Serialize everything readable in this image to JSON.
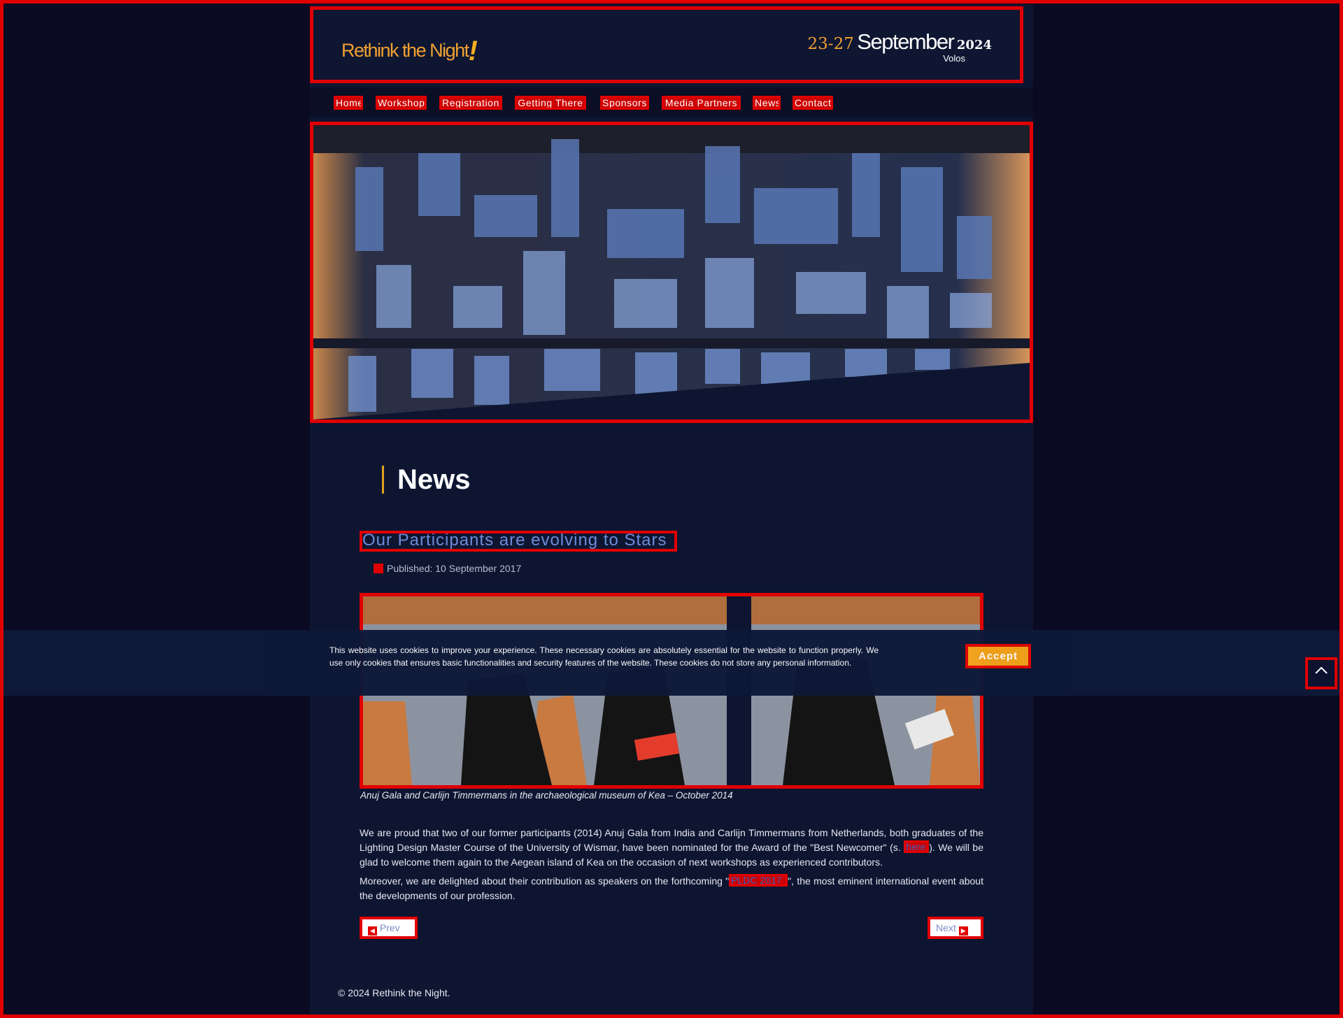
{
  "header": {
    "logo_text": "Rethink the Night",
    "logo_mark": "!",
    "dates_days": "23-27",
    "dates_month": "September",
    "dates_year": "2024",
    "city": "Volos"
  },
  "nav": {
    "items": [
      {
        "label": "Home"
      },
      {
        "label": "Workshop"
      },
      {
        "label": "Registration"
      },
      {
        "label": "Getting There"
      },
      {
        "label": "Sponsors"
      },
      {
        "label": "Media Partners"
      },
      {
        "label": "News"
      },
      {
        "label": "Contact"
      }
    ]
  },
  "page": {
    "section_title": "News",
    "article_title": "Our Participants are evolving to Stars",
    "published": "Published: 10 September 2017",
    "caption": "Anuj Gala and Carlijn Timmermans in the archaeological museum of Kea – October 2014",
    "paragraph1_part1": "We are proud that two of our former participants (2014) Anuj Gala from India and Carlijn Timmermans from Netherlands, both graduates of the Lighting Design Master Course of the University of Wismar, have been nominated for the Award of the \"Best Newcomer\" (s.",
    "paragraph1_link": "here",
    "paragraph1_part2": "). We will be glad to welcome them again to the Aegean island of Kea on the occasion of next workshops as experienced contributors.",
    "paragraph2_part1": "Moreover, we are delighted about their contribution as speakers on the forthcoming \"",
    "paragraph2_link": "PLDC 2017",
    "paragraph2_part2": "\",  the most eminent international event about the developments of our profession.",
    "prev_label": "Prev",
    "next_label": "Next"
  },
  "footer": {
    "copyright": "© 2024 Rethink the Night."
  },
  "cookie": {
    "text": "This website uses cookies to improve your experience. These necessary cookies are absolutely essential for the website to function properly. We use only cookies that ensures basic functionalities and security features of the website. These cookies do not store any personal information.",
    "accept_label": "Accept"
  },
  "icons": {
    "calendar": "calendar-icon",
    "prev": "chevron-left-icon",
    "next": "chevron-right-icon",
    "back_to_top": "chevron-up-icon"
  },
  "colors": {
    "accent": "#f0a030",
    "background": "#0d1531",
    "link": "#6d8bd8",
    "accept_button": "#f5a31a"
  }
}
